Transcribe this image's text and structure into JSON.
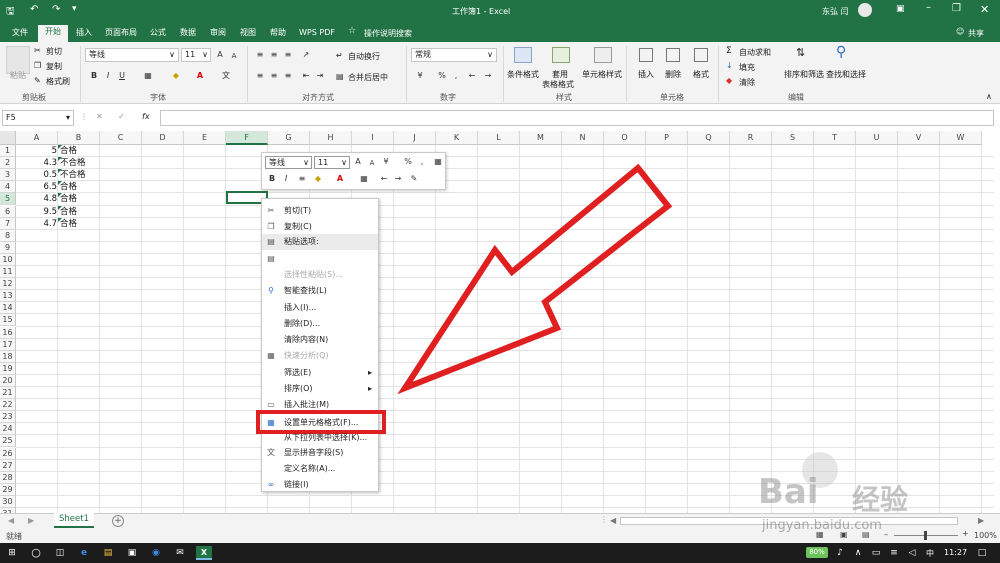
{
  "title_bar": {
    "doc_title": "工作簿1 - Excel",
    "user": "东弘 闫"
  },
  "menu": {
    "tabs": [
      "文件",
      "开始",
      "插入",
      "页面布局",
      "公式",
      "数据",
      "审阅",
      "视图",
      "帮助",
      "WPS PDF"
    ],
    "active": "开始",
    "tell_me": "操作说明搜索",
    "share": "共享"
  },
  "ribbon": {
    "clipboard": {
      "paste": "粘贴",
      "cut": "剪切",
      "copy": "复制",
      "format_painter": "格式刷",
      "label": "剪贴板"
    },
    "font": {
      "name": "等线",
      "size": "11",
      "label": "字体",
      "bold": "B",
      "italic": "I",
      "underline": "U",
      "grow": "A",
      "shrink": "A"
    },
    "alignment": {
      "wrap": "自动换行",
      "merge": "合并后居中",
      "label": "对齐方式"
    },
    "number": {
      "format": "常规",
      "percent": "%",
      "comma": ",",
      "label": "数字"
    },
    "styles": {
      "conditional": "条件格式",
      "table": "套用\n表格格式",
      "cell_styles": "单元格样式",
      "label": "样式"
    },
    "cells": {
      "insert": "插入",
      "delete": "删除",
      "format": "格式",
      "label": "单元格"
    },
    "editing": {
      "autosum": "自动求和",
      "fill": "填充",
      "clear": "清除",
      "sort": "排序和筛选",
      "find": "查找和选择",
      "label": "编辑"
    }
  },
  "formula_bar": {
    "name_box": "F5",
    "fx": "fx",
    "value": ""
  },
  "columns": [
    "A",
    "B",
    "C",
    "D",
    "E",
    "F",
    "G",
    "H",
    "I",
    "J",
    "K",
    "L",
    "M",
    "N",
    "O",
    "P",
    "Q",
    "R",
    "S",
    "T",
    "U",
    "V",
    "W"
  ],
  "rows": [
    "1",
    "2",
    "3",
    "4",
    "5",
    "6",
    "7",
    "8",
    "9",
    "10",
    "11",
    "12",
    "13",
    "14",
    "15",
    "16",
    "17",
    "18",
    "19",
    "20",
    "21",
    "22",
    "23",
    "24",
    "25",
    "26",
    "27",
    "28",
    "29",
    "30",
    "31"
  ],
  "cells": [
    {
      "a": "5",
      "b": "合格"
    },
    {
      "a": "4.3",
      "b": "不合格"
    },
    {
      "a": "0.5",
      "b": "不合格"
    },
    {
      "a": "6.5",
      "b": "合格"
    },
    {
      "a": "4.8",
      "b": "合格"
    },
    {
      "a": "9.5",
      "b": "合格"
    },
    {
      "a": "4.7",
      "b": "合格"
    }
  ],
  "mini_toolbar": {
    "font": "等线",
    "size": "11",
    "bold": "B",
    "italic": "I",
    "percent": "%",
    "comma": ","
  },
  "context_menu": [
    {
      "label": "剪切(T)",
      "disabled": false,
      "icon": "scissors-icon"
    },
    {
      "label": "复制(C)",
      "disabled": false,
      "icon": "copy-icon"
    },
    {
      "label": "粘贴选项:",
      "disabled": false,
      "icon": "paste-icon"
    },
    {
      "label": "",
      "disabled": true,
      "icon": "paste-clipboard-icon"
    },
    {
      "label": "选择性粘贴(S)...",
      "disabled": true,
      "icon": ""
    },
    {
      "label": "智能查找(L)",
      "disabled": false,
      "icon": "smart-lookup-icon"
    },
    {
      "label": "插入(I)...",
      "disabled": false,
      "icon": ""
    },
    {
      "label": "删除(D)...",
      "disabled": false,
      "icon": ""
    },
    {
      "label": "清除内容(N)",
      "disabled": false,
      "icon": ""
    },
    {
      "label": "快速分析(Q)",
      "disabled": true,
      "icon": "quick-analysis-icon"
    },
    {
      "label": "筛选(E)",
      "disabled": false,
      "icon": "",
      "submenu": true
    },
    {
      "label": "排序(O)",
      "disabled": false,
      "icon": "",
      "submenu": true
    },
    {
      "label": "插入批注(M)",
      "disabled": false,
      "icon": "comment-icon"
    },
    {
      "label": "设置单元格格式(F)...",
      "disabled": false,
      "icon": "format-cells-icon",
      "highlighted": true
    },
    {
      "label": "从下拉列表中选择(K)...",
      "disabled": false,
      "icon": ""
    },
    {
      "label": "显示拼音字段(S)",
      "disabled": false,
      "icon": "phonetic-icon"
    },
    {
      "label": "定义名称(A)...",
      "disabled": false,
      "icon": ""
    },
    {
      "label": "链接(I)",
      "disabled": false,
      "icon": "link-icon"
    }
  ],
  "sheet_tabs": {
    "active": "Sheet1",
    "add": "+"
  },
  "status_bar": {
    "mode": "就绪",
    "zoom": "100%"
  },
  "taskbar": {
    "battery": "80%",
    "time": "11:27",
    "lang": "中"
  },
  "watermark": {
    "brand": "Bai",
    "suffix": "经验",
    "url": "jingyan.baidu.com"
  },
  "colors": {
    "excel_green": "#217346",
    "arrow_red": "#e02020",
    "taskbar": "#1c1c1c"
  }
}
